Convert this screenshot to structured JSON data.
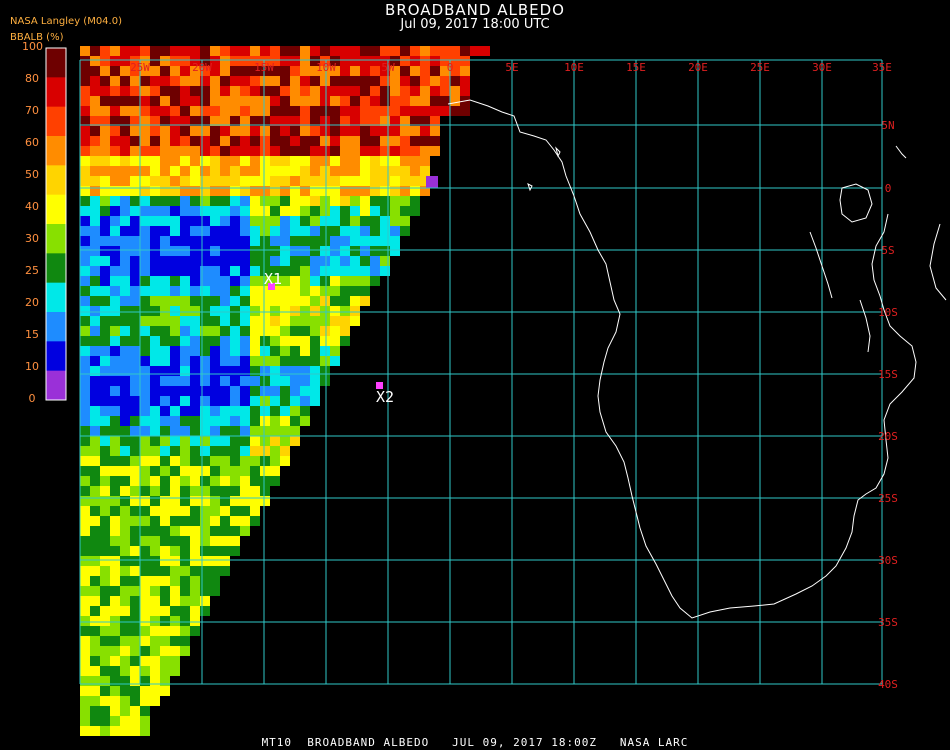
{
  "header": {
    "title": "BROADBAND ALBEDO",
    "subtitle": "Jul 09, 2017 18:00 UTC",
    "source": "NASA Langley (M04.0)",
    "unit_label": "BBALB (%)"
  },
  "colorbar": {
    "ticks": [
      "100",
      "80",
      "70",
      "60",
      "50",
      "40",
      "30",
      "25",
      "20",
      "15",
      "10",
      "0"
    ],
    "colors": [
      "#6e0000",
      "#d80000",
      "#ff4000",
      "#ff8c00",
      "#ffd400",
      "#ffff00",
      "#88e000",
      "#108810",
      "#00e8e8",
      "#1e8cff",
      "#0000e0",
      "#9a30d8"
    ]
  },
  "map": {
    "lon_labels": [
      "25W",
      "20W",
      "15W",
      "10W",
      "5W",
      "0",
      "5E",
      "10E",
      "15E",
      "20E",
      "25E",
      "30E",
      "35E"
    ],
    "lat_labels": [
      "5N",
      "0",
      "5S",
      "10S",
      "15S",
      "20S",
      "25S",
      "30S",
      "35S",
      "40S"
    ],
    "grid_color": "#30c8c8",
    "label_color": "#e02020",
    "markers": [
      {
        "label": "X1",
        "color": "#ff40ff"
      },
      {
        "label": "X2",
        "color": "#ff40ff"
      }
    ]
  },
  "footer": "MT10  BROADBAND ALBEDO   JUL 09, 2017 18:00Z   NASA LARC"
}
